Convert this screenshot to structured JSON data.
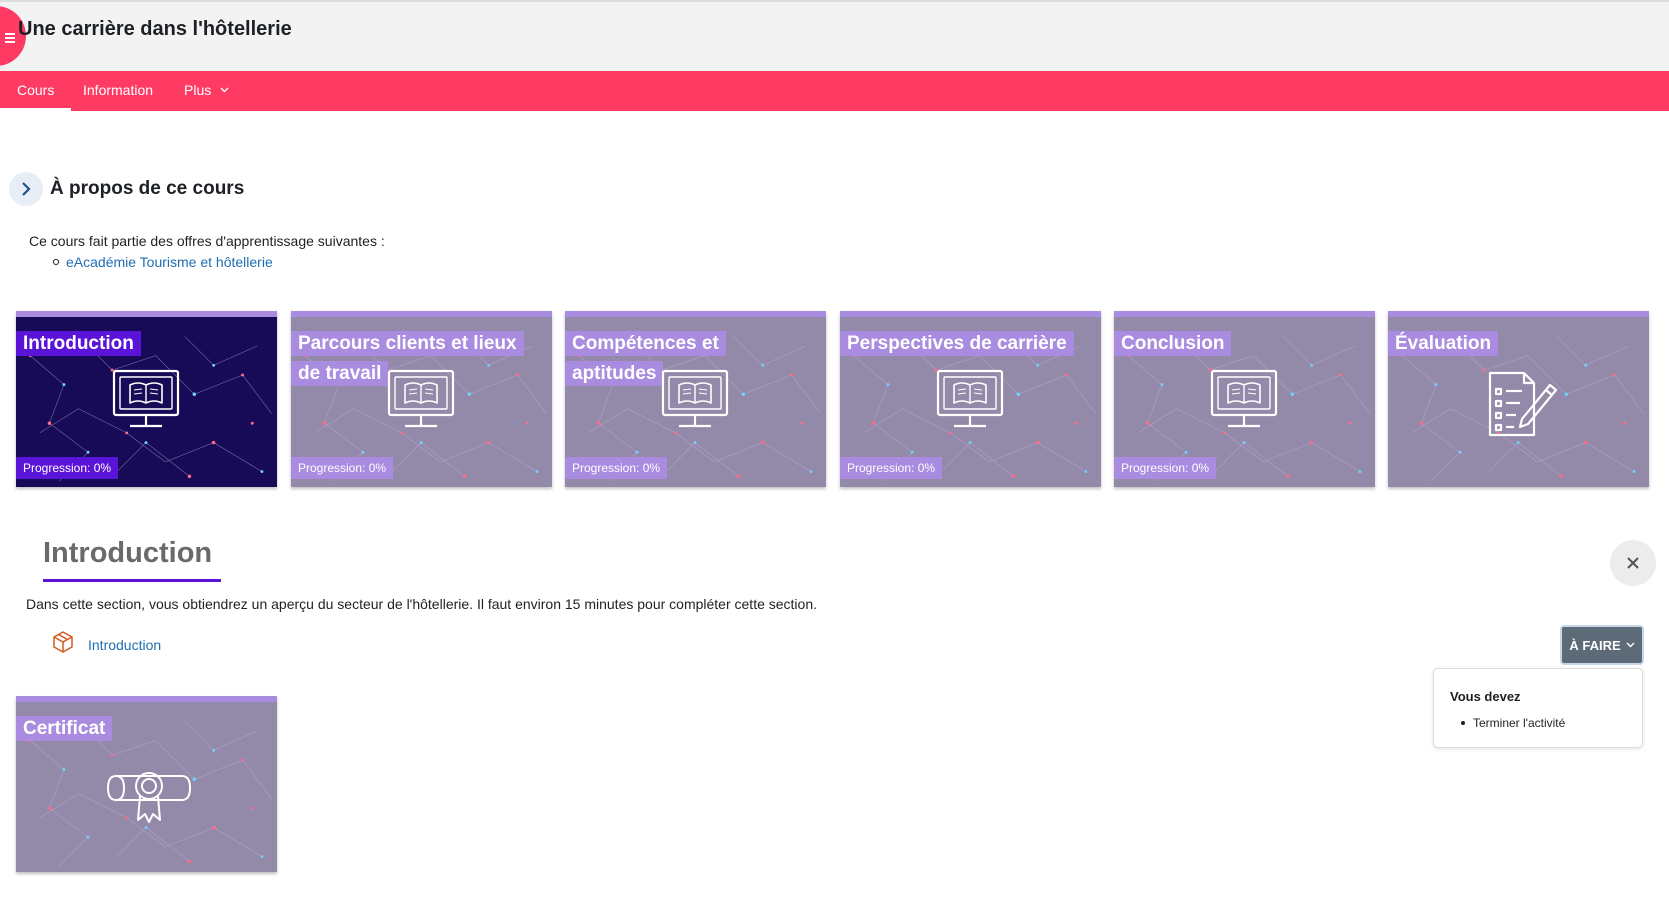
{
  "header": {
    "course_title": "Une carrière dans l'hôtellerie"
  },
  "nav": {
    "items": [
      {
        "label": "Cours",
        "active": true
      },
      {
        "label": "Information",
        "active": false
      },
      {
        "label": "Plus",
        "active": false
      }
    ]
  },
  "about": {
    "title": "À propos de ce cours",
    "intro": "Ce cours fait partie des offres d'apprentissage suivantes :",
    "offer_link": "eAcadémie Tourisme et hôtellerie"
  },
  "tiles": [
    {
      "title": "Introduction",
      "progress": "Progression: 0%",
      "icon": "monitor-book-icon",
      "active": true
    },
    {
      "title": "Parcours clients et lieux de travail",
      "progress": "Progression: 0%",
      "icon": "monitor-book-icon"
    },
    {
      "title": "Compétences et aptitudes",
      "progress": "Progression: 0%",
      "icon": "monitor-book-icon"
    },
    {
      "title": "Perspectives de carrière",
      "progress": "Progression: 0%",
      "icon": "monitor-book-icon"
    },
    {
      "title": "Conclusion",
      "progress": "Progression: 0%",
      "icon": "monitor-book-icon"
    },
    {
      "title": "Évaluation",
      "icon": "checklist-pen-icon"
    },
    {
      "title": "Certificat",
      "icon": "certificate-icon"
    }
  ],
  "section": {
    "title": "Introduction",
    "description": "Dans cette section, vous obtiendrez un aperçu du secteur de l'hôtellerie. Il faut environ 15 minutes pour compléter cette section.",
    "activity_link": "Introduction",
    "activity_icon": "package-icon",
    "todo_label": "À FAIRE",
    "popover": {
      "title": "Vous devez",
      "item": "Terminer l'activité"
    }
  },
  "colors": {
    "brand": "#ff3b64",
    "accent": "#5a14d8",
    "tile_label": "#a98ce0",
    "tile_bg": "#9389a8",
    "link": "#1f6fb2"
  }
}
